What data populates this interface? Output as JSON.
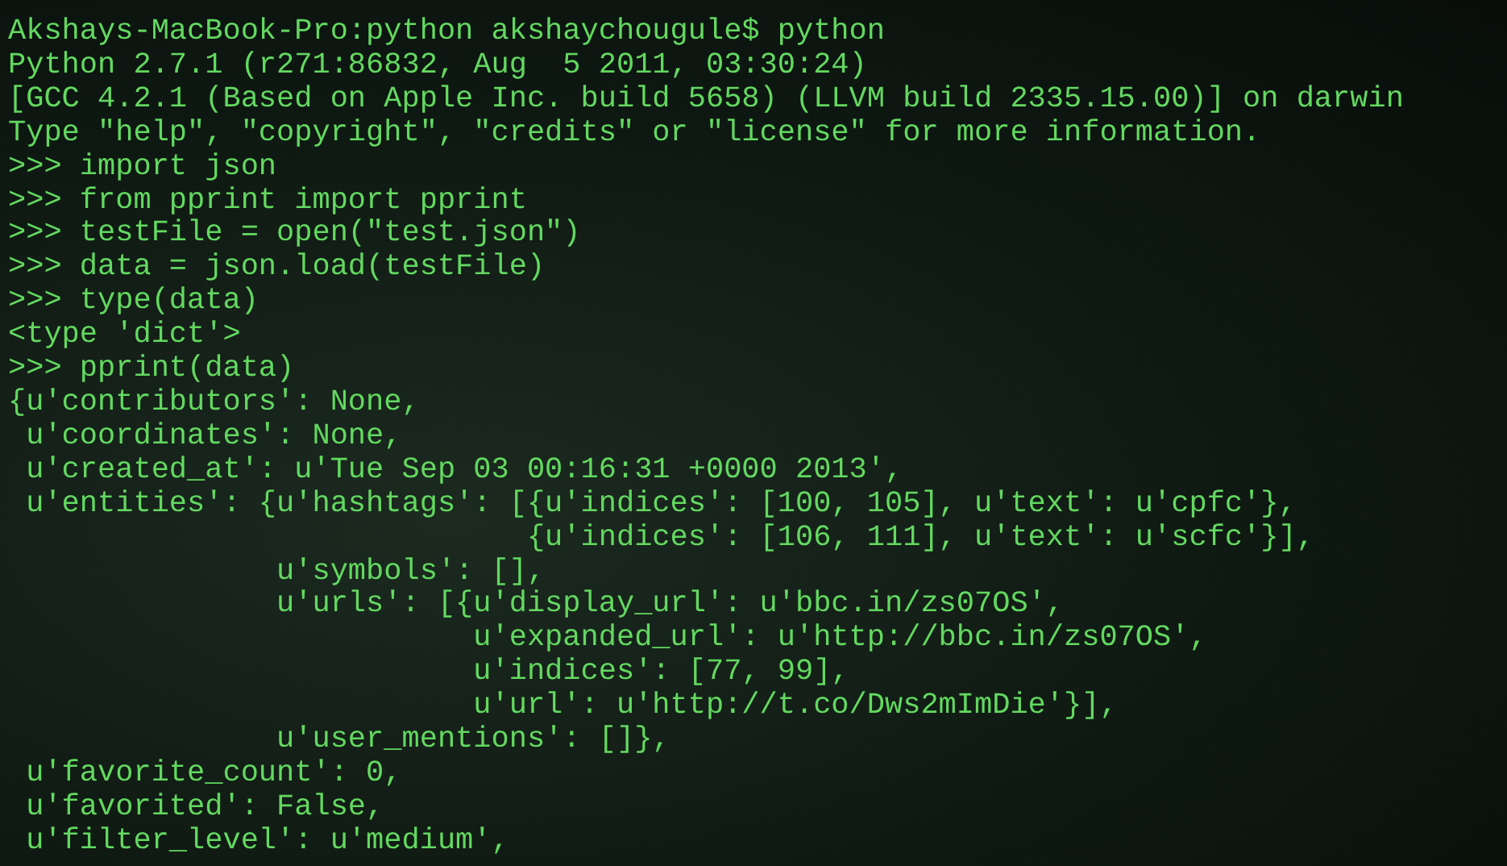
{
  "terminal": {
    "lines": [
      "Akshays-MacBook-Pro:python akshaychougule$ python",
      "Python 2.7.1 (r271:86832, Aug  5 2011, 03:30:24)",
      "[GCC 4.2.1 (Based on Apple Inc. build 5658) (LLVM build 2335.15.00)] on darwin",
      "Type \"help\", \"copyright\", \"credits\" or \"license\" for more information.",
      ">>> import json",
      ">>> from pprint import pprint",
      ">>> testFile = open(\"test.json\")",
      ">>> data = json.load(testFile)",
      ">>> type(data)",
      "<type 'dict'>",
      ">>> pprint(data)",
      "{u'contributors': None,",
      " u'coordinates': None,",
      " u'created_at': u'Tue Sep 03 00:16:31 +0000 2013',",
      " u'entities': {u'hashtags': [{u'indices': [100, 105], u'text': u'cpfc'},",
      "                             {u'indices': [106, 111], u'text': u'scfc'}],",
      "               u'symbols': [],",
      "               u'urls': [{u'display_url': u'bbc.in/zs07OS',",
      "                          u'expanded_url': u'http://bbc.in/zs07OS',",
      "                          u'indices': [77, 99],",
      "                          u'url': u'http://t.co/Dws2mImDie'}],",
      "               u'user_mentions': []},",
      " u'favorite_count': 0,",
      " u'favorited': False,",
      " u'filter_level': u'medium',"
    ]
  }
}
